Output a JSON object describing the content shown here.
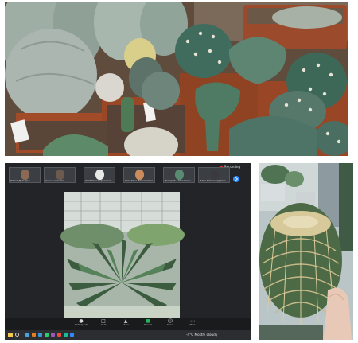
{
  "meeting": {
    "recording_label": "Recording",
    "participants": [
      {
        "name": "Олеся Давыдов",
        "icon": "participant-video-icon"
      },
      {
        "name": "Анна Антонова",
        "icon": "participant-video-icon"
      },
      {
        "name": "Светлана Сергеевна",
        "icon": "participant-video-icon"
      },
      {
        "name": "Светлана Николаевна",
        "icon": "participant-video-icon"
      },
      {
        "name": "Валерий Алексеевич",
        "icon": "participant-video-icon"
      },
      {
        "name": "Олег Александрович",
        "icon": "participant-video-icon"
      }
    ],
    "toolbar": [
      {
        "label": "Participants",
        "icon": "participants-icon"
      },
      {
        "label": "Chat",
        "icon": "chat-icon"
      },
      {
        "label": "Share",
        "icon": "share-icon"
      },
      {
        "label": "Record",
        "icon": "record-icon"
      },
      {
        "label": "React",
        "icon": "react-icon"
      },
      {
        "label": "More",
        "icon": "more-icon"
      }
    ]
  },
  "taskbar": {
    "weather": "-4°C Mostly cloudy",
    "start_icon": "windows-start-icon",
    "search_icon": "search-icon"
  },
  "colors": {
    "recording_dot": "#e0352b",
    "zoom_bg": "#222427",
    "share_green": "#23b35b",
    "next_arrow": "#2d8cff"
  }
}
